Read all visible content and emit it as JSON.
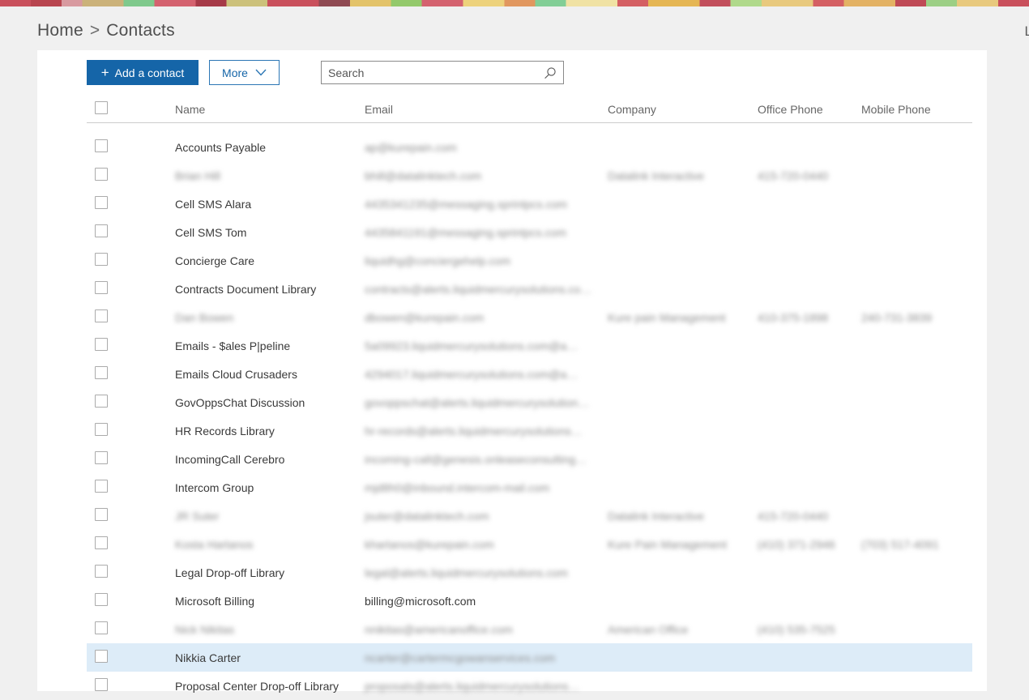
{
  "header": {
    "breadcrumb": {
      "home": "Home",
      "separator": ">",
      "current": "Contacts"
    },
    "top_right_text": "L"
  },
  "toolbar": {
    "add_label": "Add a contact",
    "add_icon": "+",
    "more_label": "More",
    "search_placeholder": "Search"
  },
  "colors": {
    "accent_blue": "#1565a8",
    "selected_row": "#ddecf8",
    "page_background": "#f0f0f0"
  },
  "table": {
    "columns": [
      "Name",
      "Email",
      "Company",
      "Office Phone",
      "Mobile Phone"
    ],
    "rows": [
      {
        "name": {
          "text": "Accounts Payable",
          "redacted": false
        },
        "email": {
          "text": "ap@kurepain.com",
          "redacted": true
        },
        "company": null,
        "office_phone": null,
        "mobile_phone": null
      },
      {
        "name": {
          "text": "Brian Hill",
          "redacted": true
        },
        "email": {
          "text": "bhill@datalinktech.com",
          "redacted": true
        },
        "company": {
          "text": "Datalink Interactive",
          "redacted": true
        },
        "office_phone": {
          "text": "415-720-0440",
          "redacted": true
        },
        "mobile_phone": null
      },
      {
        "name": {
          "text": "Cell SMS Alara",
          "redacted": false
        },
        "email": {
          "text": "4435341235@messaging.sprintpcs.com",
          "redacted": true
        },
        "company": null,
        "office_phone": null,
        "mobile_phone": null
      },
      {
        "name": {
          "text": "Cell SMS Tom",
          "redacted": false
        },
        "email": {
          "text": "4435841191@messaging.sprintpcs.com",
          "redacted": true
        },
        "company": null,
        "office_phone": null,
        "mobile_phone": null
      },
      {
        "name": {
          "text": "Concierge Care",
          "redacted": false
        },
        "email": {
          "text": "liquidhg@conciergehelp.com",
          "redacted": true
        },
        "company": null,
        "office_phone": null,
        "mobile_phone": null
      },
      {
        "name": {
          "text": "Contracts Document Library",
          "redacted": false
        },
        "email": {
          "text": "contracts@alerts.liquidmercurysolutions.co…",
          "redacted": true
        },
        "company": null,
        "office_phone": null,
        "mobile_phone": null
      },
      {
        "name": {
          "text": "Dan Bowen",
          "redacted": true
        },
        "email": {
          "text": "dbowen@kurepain.com",
          "redacted": true
        },
        "company": {
          "text": "Kure pain Management",
          "redacted": true
        },
        "office_phone": {
          "text": "410-375-1898",
          "redacted": true
        },
        "mobile_phone": {
          "text": "240-731-3839",
          "redacted": true
        }
      },
      {
        "name": {
          "text": "Emails - $ales P|peline",
          "redacted": false
        },
        "email": {
          "text": "5a09923.liquidmercurysolutions.com@a…",
          "redacted": true
        },
        "company": null,
        "office_phone": null,
        "mobile_phone": null
      },
      {
        "name": {
          "text": "Emails Cloud Crusaders",
          "redacted": false
        },
        "email": {
          "text": "4294017.liquidmercurysolutions.com@a…",
          "redacted": true
        },
        "company": null,
        "office_phone": null,
        "mobile_phone": null
      },
      {
        "name": {
          "text": "GovOppsChat Discussion",
          "redacted": false
        },
        "email": {
          "text": "govoppschat@alerts.liquidmercurysolution…",
          "redacted": true
        },
        "company": null,
        "office_phone": null,
        "mobile_phone": null
      },
      {
        "name": {
          "text": "HR Records Library",
          "redacted": false
        },
        "email": {
          "text": "hr-records@alerts.liquidmercurysolutions…",
          "redacted": true
        },
        "company": null,
        "office_phone": null,
        "mobile_phone": null
      },
      {
        "name": {
          "text": "IncomingCall Cerebro",
          "redacted": false
        },
        "email": {
          "text": "incoming-call@genesis.onleaseconsulting…",
          "redacted": true
        },
        "company": null,
        "office_phone": null,
        "mobile_phone": null
      },
      {
        "name": {
          "text": "Intercom Group",
          "redacted": false
        },
        "email": {
          "text": "mjd8h0@inbound.intercom-mail.com",
          "redacted": true
        },
        "company": null,
        "office_phone": null,
        "mobile_phone": null
      },
      {
        "name": {
          "text": "JR Suter",
          "redacted": true
        },
        "email": {
          "text": "jsuter@datalinktech.com",
          "redacted": true
        },
        "company": {
          "text": "Datalink Interactive",
          "redacted": true
        },
        "office_phone": {
          "text": "415-720-0440",
          "redacted": true
        },
        "mobile_phone": null
      },
      {
        "name": {
          "text": "Kosta Hartanos",
          "redacted": true
        },
        "email": {
          "text": "khartanos@kurepain.com",
          "redacted": true
        },
        "company": {
          "text": "Kure Pain Management",
          "redacted": true
        },
        "office_phone": {
          "text": "(410) 371-2946",
          "redacted": true
        },
        "mobile_phone": {
          "text": "(703) 517-4091",
          "redacted": true
        }
      },
      {
        "name": {
          "text": "Legal Drop-off Library",
          "redacted": false
        },
        "email": {
          "text": "legal@alerts.liquidmercurysolutions.com",
          "redacted": true
        },
        "company": null,
        "office_phone": null,
        "mobile_phone": null
      },
      {
        "name": {
          "text": "Microsoft Billing",
          "redacted": false
        },
        "email": {
          "text": "billing@microsoft.com",
          "redacted": false
        },
        "company": null,
        "office_phone": null,
        "mobile_phone": null
      },
      {
        "name": {
          "text": "Nick Nikitas",
          "redacted": true
        },
        "email": {
          "text": "nnikitas@americanoffice.com",
          "redacted": true
        },
        "company": {
          "text": "American Office",
          "redacted": true
        },
        "office_phone": {
          "text": "(410) 535-7525",
          "redacted": true
        },
        "mobile_phone": null
      },
      {
        "name": {
          "text": "Nikkia Carter",
          "redacted": false
        },
        "selected": true,
        "email": {
          "text": "ncarter@cartermcgowanservices.com",
          "redacted": true
        },
        "company": null,
        "office_phone": null,
        "mobile_phone": null
      },
      {
        "name": {
          "text": "Proposal Center Drop-off Library",
          "redacted": false
        },
        "email": {
          "text": "proposals@alerts.liquidmercurysolutions…",
          "redacted": true
        },
        "company": null,
        "office_phone": null,
        "mobile_phone": null
      }
    ]
  }
}
